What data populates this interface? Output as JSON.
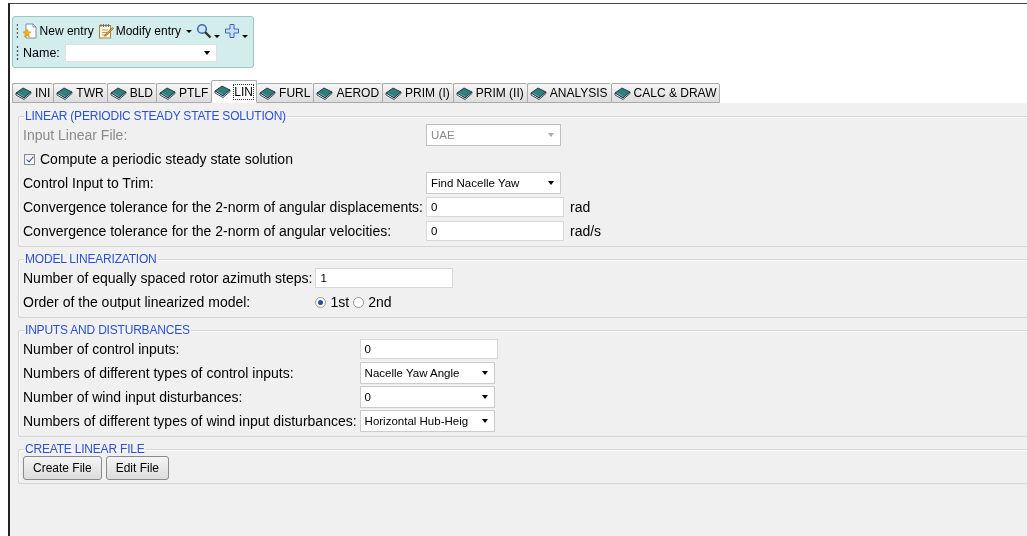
{
  "toolbar": {
    "buttons": [
      {
        "kind": "new",
        "label": "New entry",
        "menu": false
      },
      {
        "kind": "modify",
        "label": "Modify entry",
        "menu": true
      },
      {
        "kind": "search",
        "menu": true
      },
      {
        "kind": "add",
        "menu": true
      }
    ],
    "name_field": {
      "label": "Name:"
    }
  },
  "tabs": [
    {
      "label": "INI",
      "selected": false
    },
    {
      "label": "TWR",
      "selected": false
    },
    {
      "label": "BLD",
      "selected": false
    },
    {
      "label": "PTLF",
      "selected": false
    },
    {
      "label": "LIN",
      "selected": true
    },
    {
      "label": "FURL",
      "selected": false
    },
    {
      "label": "AEROD",
      "selected": false
    },
    {
      "label": "PRIM (I)",
      "selected": false
    },
    {
      "label": "PRIM (II)",
      "selected": false
    },
    {
      "label": "ANALYSIS",
      "selected": false
    },
    {
      "label": "CALC & DRAW",
      "selected": false
    }
  ],
  "sections": [
    {
      "title": "LINEAR (PERIODIC STEADY STATE SOLUTION)",
      "rows": [
        {
          "kind": "dropdown",
          "label": "Input Linear File:",
          "value": "UAE",
          "disabled": true
        },
        {
          "kind": "checkbox",
          "label": "Compute a periodic steady state solution",
          "checked": true
        },
        {
          "kind": "dropdown",
          "label": "Control Input to Trim:",
          "value": "Find Nacelle Yaw",
          "disabled": false
        },
        {
          "kind": "text",
          "label": "Convergence tolerance for the 2-norm of angular displacements:",
          "value": "0",
          "unit": "rad"
        },
        {
          "kind": "text",
          "label": "Convergence tolerance for the 2-norm of angular velocities:",
          "value": "0",
          "unit": "rad/s"
        }
      ]
    },
    {
      "title": "MODEL LINEARIZATION",
      "rows": [
        {
          "kind": "text",
          "label": "Number of equally spaced rotor azimuth steps:",
          "value": "1"
        },
        {
          "kind": "radio",
          "label": "Order of the output linearized model:",
          "options": [
            {
              "label": "1st",
              "selected": true
            },
            {
              "label": "2nd",
              "selected": false
            }
          ]
        }
      ]
    },
    {
      "title": "INPUTS AND DISTURBANCES",
      "rows": [
        {
          "kind": "text",
          "label": "Number of control inputs:",
          "value": "0"
        },
        {
          "kind": "dropdown",
          "label": "Numbers of different types of control inputs:",
          "value": "Nacelle Yaw Angle",
          "disabled": false
        },
        {
          "kind": "dropdown",
          "label": "Number of wind input disturbances:",
          "value": "0",
          "disabled": false
        },
        {
          "kind": "dropdown",
          "label": "Numbers of different types of wind input disturbances:",
          "value": "Horizontal Hub-Heig",
          "disabled": false
        }
      ]
    },
    {
      "title": "CREATE LINEAR FILE",
      "rows": [
        {
          "kind": "buttons",
          "buttons": [
            {
              "label": "Create File"
            },
            {
              "label": "Edit File"
            }
          ]
        }
      ]
    }
  ]
}
